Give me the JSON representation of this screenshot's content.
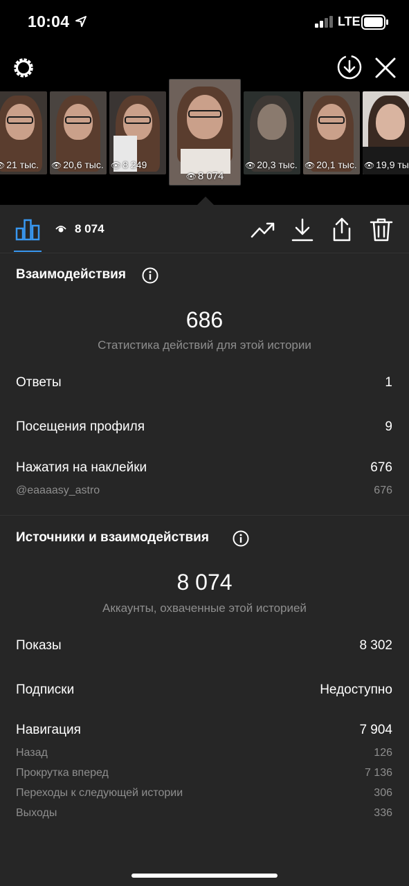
{
  "status": {
    "time": "10:04",
    "network": "LTE"
  },
  "strip": {
    "stories": [
      {
        "views": "21 тыс."
      },
      {
        "views": "20,6 тыс."
      },
      {
        "views": "8 249"
      },
      {
        "views": "8 074",
        "selected": true
      },
      {
        "views": "20,3 тыс."
      },
      {
        "views": "20,1 тыс."
      },
      {
        "views": "19,9 тыс."
      }
    ]
  },
  "action_bar": {
    "view_count": "8 074"
  },
  "interactions": {
    "title": "Взаимодействия",
    "total": "686",
    "subtitle": "Статистика действий для этой истории",
    "rows": [
      {
        "label": "Ответы",
        "value": "1"
      },
      {
        "label": "Посещения профиля",
        "value": "9"
      },
      {
        "label": "Нажатия на наклейки",
        "value": "676"
      }
    ],
    "sticker_rows": [
      {
        "label": "@eaaaasy_astro",
        "value": "676"
      }
    ]
  },
  "discovery": {
    "title": "Источники и взаимодействия",
    "total": "8 074",
    "subtitle": "Аккаунты, охваченные этой историей",
    "rows": [
      {
        "label": "Показы",
        "value": "8 302"
      },
      {
        "label": "Подписки",
        "value": "Недоступно"
      },
      {
        "label": "Навигация",
        "value": "7 904"
      }
    ],
    "nav_rows": [
      {
        "label": "Назад",
        "value": "126"
      },
      {
        "label": "Прокрутка вперед",
        "value": "7 136"
      },
      {
        "label": "Переходы к следующей истории",
        "value": "306"
      },
      {
        "label": "Выходы",
        "value": "336"
      }
    ]
  },
  "colors": {
    "accent": "#3897f0",
    "panel": "#262626",
    "muted": "#8e8e8e"
  }
}
